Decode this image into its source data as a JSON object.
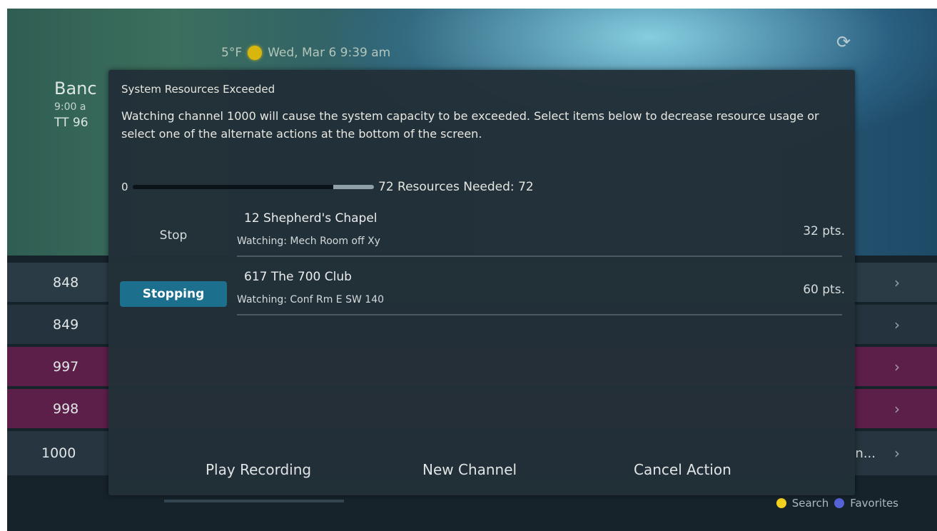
{
  "status": {
    "temperature": "5°F",
    "datetime": "Wed, Mar 6 9:39 am"
  },
  "background_program": {
    "title": "Banc",
    "time": "9:00 a",
    "subtitle": "TT 96"
  },
  "guide": {
    "rows": [
      {
        "number": "848"
      },
      {
        "number": "849"
      },
      {
        "number": "997"
      },
      {
        "number": "998"
      },
      {
        "number": "1000",
        "extra": "n..."
      }
    ]
  },
  "footer": {
    "search_label": "Search",
    "favorites_label": "Favorites"
  },
  "dialog": {
    "title": "System Resources Exceeded",
    "message": "Watching channel 1000 will cause the system capacity to be exceeded. Select items below to decrease resource usage or select one of the alternate actions at the bottom of the screen.",
    "resources": {
      "min": "0",
      "max_and_needed": "72 Resources Needed: 72",
      "max": 72,
      "needed": 72,
      "freed_fraction": 0.17
    },
    "items": [
      {
        "button": "Stop",
        "active": false,
        "channel": "12  Shepherd's Chapel",
        "watching": "Watching: Mech Room off Xy",
        "points": "32 pts."
      },
      {
        "button": "Stopping",
        "active": true,
        "channel": "617  The 700 Club",
        "watching": "Watching: Conf Rm E SW 140",
        "points": "60 pts."
      }
    ],
    "actions": {
      "play_recording": "Play Recording",
      "new_channel": "New Channel",
      "cancel_action": "Cancel Action"
    }
  },
  "colors": {
    "accent_active": "#1d6f8e",
    "favorite_row": "#5c1f4a",
    "search_dot": "#f3d21f",
    "favorites_dot": "#5662d8"
  }
}
